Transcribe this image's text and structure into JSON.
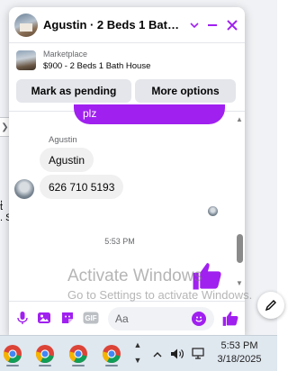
{
  "background": {
    "fragments": [
      ",",
      "t",
      ". S"
    ]
  },
  "chat": {
    "title": "Agustin · 2 Beds 1 Bath Ho…",
    "listing": {
      "label": "Marketplace",
      "description": "$900 - 2 Beds 1 Bath House"
    },
    "buttons": {
      "mark_pending": "Mark as pending",
      "more_options": "More options"
    },
    "messages": [
      {
        "from": "me",
        "text": "plz"
      },
      {
        "from": "them",
        "sender": "Agustin",
        "text": "Agustin"
      },
      {
        "from": "them",
        "text": "626 710 5193"
      }
    ],
    "timestamp": "5:53 PM",
    "composer": {
      "placeholder": "Aa",
      "icons": [
        "microphone-icon",
        "image-icon",
        "sticker-icon",
        "gif-icon",
        "emoji-icon",
        "thumbs-up-icon"
      ]
    },
    "accent_color": "#a020f0"
  },
  "watermark": {
    "title": "Activate Windows",
    "subtitle": "Go to Settings to activate Windows."
  },
  "taskbar": {
    "app_icon": "chrome-icon",
    "pinned_count": 4,
    "tray_icons": [
      "chevron-up-icon",
      "volume-icon",
      "network-icon"
    ],
    "time": "5:53 PM",
    "date": "3/18/2025"
  }
}
